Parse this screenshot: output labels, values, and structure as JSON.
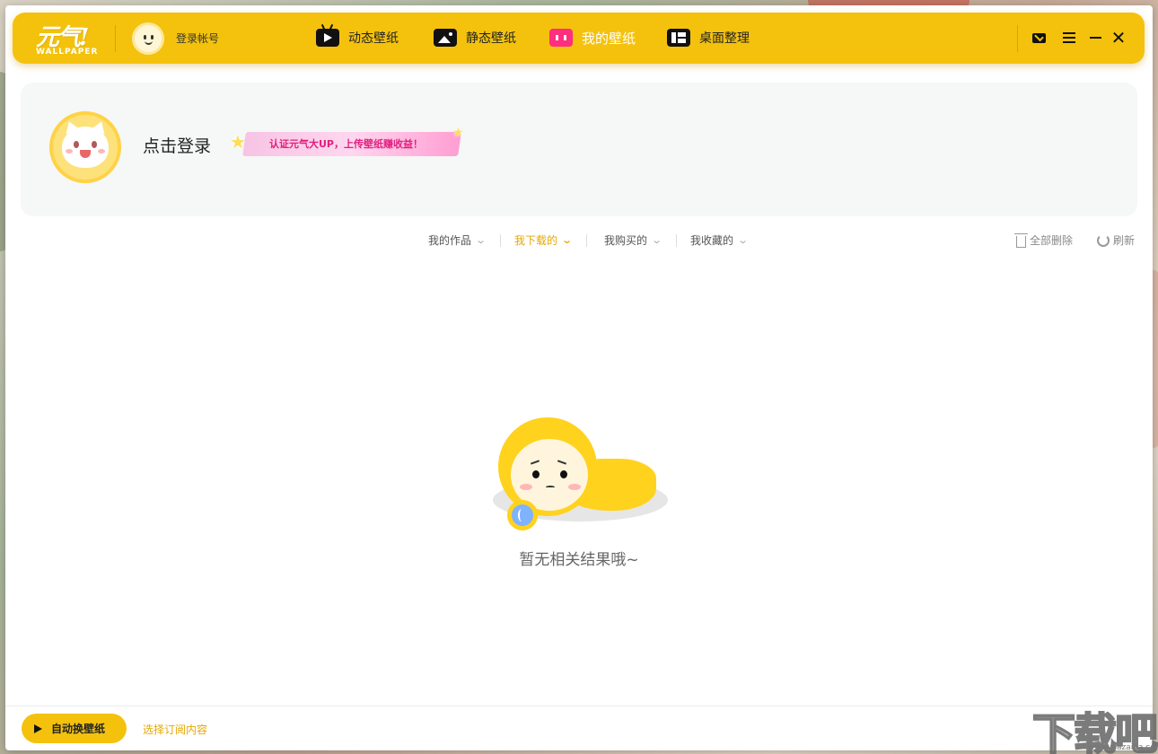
{
  "app": {
    "logo_text": "元气!",
    "logo_subtext": "WALLPAPER",
    "login_label": "登录帐号"
  },
  "nav": [
    {
      "label": "动态壁纸",
      "icon": "tv-play-icon",
      "active": false
    },
    {
      "label": "静态壁纸",
      "icon": "image-icon",
      "active": false
    },
    {
      "label": "我的壁纸",
      "icon": "my-wallpaper-icon",
      "active": true
    },
    {
      "label": "桌面整理",
      "icon": "desktop-organize-icon",
      "active": false
    }
  ],
  "window_controls": {
    "mail": "mail-icon",
    "menu": "menu-icon",
    "minimize": "minimize-icon",
    "close": "close-icon"
  },
  "profile": {
    "login_prompt": "点击登录",
    "promo": "认证元气大UP，上传壁纸赚收益！"
  },
  "filters": [
    {
      "label": "我的作品",
      "active": false
    },
    {
      "label": "我下载的",
      "active": true
    },
    {
      "label": "我购买的",
      "active": false
    },
    {
      "label": "我收藏的",
      "active": false
    }
  ],
  "tools": {
    "delete_all": "全部删除",
    "refresh": "刷新"
  },
  "empty_state": {
    "message": "暂无相关结果哦~"
  },
  "bottom": {
    "auto_switch": "自动换壁纸",
    "subscribe": "选择订阅内容"
  },
  "watermark": {
    "text": "下载吧",
    "url": "www.xiazaiba.com"
  },
  "colors": {
    "accent": "#f4c20d",
    "active_filter": "#e6a700",
    "active_nav_icon": "#ff2e7e",
    "promo_text": "#e0207e"
  }
}
